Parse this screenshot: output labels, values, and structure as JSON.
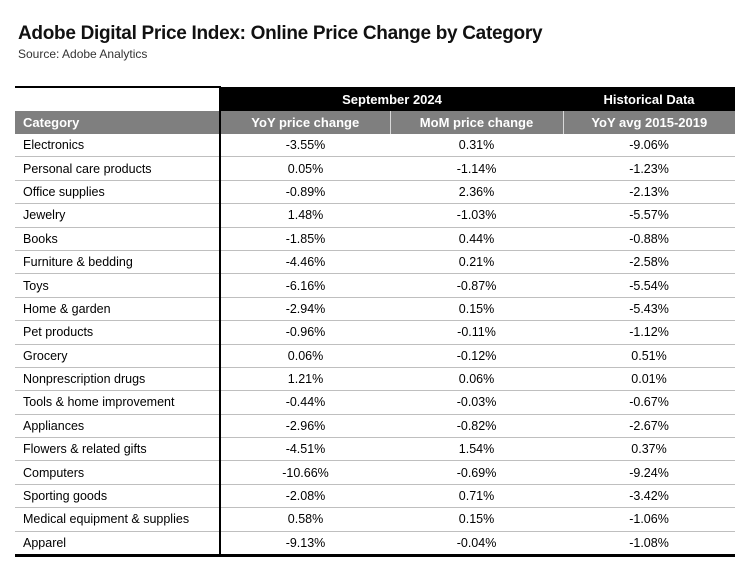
{
  "header": {
    "title": "Adobe Digital Price Index: Online Price Change by Category",
    "subtitle": "Source: Adobe Analytics"
  },
  "table": {
    "group_headers": {
      "current": "September 2024",
      "historical": "Historical Data"
    },
    "columns": [
      "Category",
      "YoY price change",
      "MoM price change",
      "YoY avg 2015-2019"
    ],
    "rows": [
      [
        "Electronics",
        "-3.55%",
        "0.31%",
        "-9.06%"
      ],
      [
        "Personal care products",
        "0.05%",
        "-1.14%",
        "-1.23%"
      ],
      [
        "Office supplies",
        "-0.89%",
        "2.36%",
        "-2.13%"
      ],
      [
        "Jewelry",
        "1.48%",
        "-1.03%",
        "-5.57%"
      ],
      [
        "Books",
        "-1.85%",
        "0.44%",
        "-0.88%"
      ],
      [
        "Furniture & bedding",
        "-4.46%",
        "0.21%",
        "-2.58%"
      ],
      [
        "Toys",
        "-6.16%",
        "-0.87%",
        "-5.54%"
      ],
      [
        "Home & garden",
        "-2.94%",
        "0.15%",
        "-5.43%"
      ],
      [
        "Pet products",
        "-0.96%",
        "-0.11%",
        "-1.12%"
      ],
      [
        "Grocery",
        "0.06%",
        "-0.12%",
        "0.51%"
      ],
      [
        "Nonprescription drugs",
        "1.21%",
        "0.06%",
        "0.01%"
      ],
      [
        "Tools & home improvement",
        "-0.44%",
        "-0.03%",
        "-0.67%"
      ],
      [
        "Appliances",
        "-2.96%",
        "-0.82%",
        "-2.67%"
      ],
      [
        "Flowers & related gifts",
        "-4.51%",
        "1.54%",
        "0.37%"
      ],
      [
        "Computers",
        "-10.66%",
        "-0.69%",
        "-9.24%"
      ],
      [
        "Sporting goods",
        "-2.08%",
        "0.71%",
        "-3.42%"
      ],
      [
        "Medical equipment & supplies",
        "0.58%",
        "0.15%",
        "-1.06%"
      ],
      [
        "Apparel",
        "-9.13%",
        "-0.04%",
        "-1.08%"
      ]
    ]
  },
  "colors": {
    "group_header_bg": "#000000",
    "column_header_bg": "#7f7f7f",
    "row_divider": "#bfbfbf"
  }
}
